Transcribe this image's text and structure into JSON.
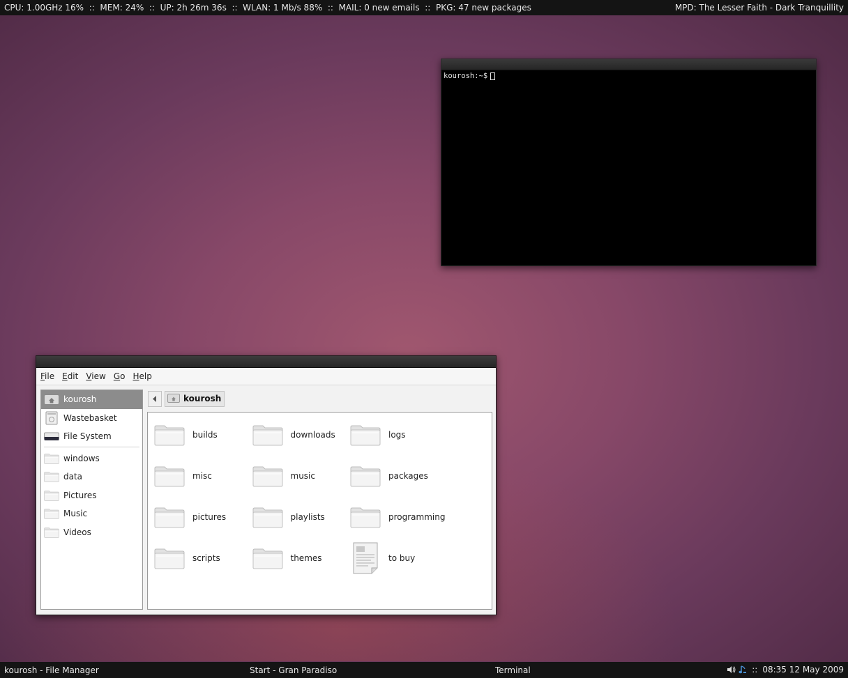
{
  "topbar": {
    "left": "CPU: 1.00GHz 16%  ::  MEM: 24%  ::  UP: 2h 26m 36s  ::  WLAN: 1 Mb/s 88%  ::  MAIL: 0 new emails  ::  PKG: 47 new packages",
    "right": "MPD: The Lesser Faith - Dark Tranquillity"
  },
  "terminal": {
    "prompt": "kourosh:~$"
  },
  "file_manager": {
    "menu": [
      {
        "key": "F",
        "rest": "ile"
      },
      {
        "key": "E",
        "rest": "dit"
      },
      {
        "key": "V",
        "rest": "iew"
      },
      {
        "key": "G",
        "rest": "o"
      },
      {
        "key": "H",
        "rest": "elp"
      }
    ],
    "sidebar": {
      "places": [
        {
          "label": "kourosh",
          "icon": "home-icon"
        },
        {
          "label": "Wastebasket",
          "icon": "trash-icon"
        },
        {
          "label": "File System",
          "icon": "drive-icon"
        }
      ],
      "bookmarks": [
        {
          "label": "windows",
          "icon": "folder-icon"
        },
        {
          "label": "data",
          "icon": "folder-icon"
        },
        {
          "label": "Pictures",
          "icon": "folder-icon"
        },
        {
          "label": "Music",
          "icon": "folder-icon"
        },
        {
          "label": "Videos",
          "icon": "folder-icon"
        }
      ]
    },
    "path": {
      "current": "kourosh"
    },
    "files": [
      {
        "name": "builds",
        "type": "folder"
      },
      {
        "name": "downloads",
        "type": "folder"
      },
      {
        "name": "logs",
        "type": "folder"
      },
      {
        "name": "misc",
        "type": "folder"
      },
      {
        "name": "music",
        "type": "folder"
      },
      {
        "name": "packages",
        "type": "folder"
      },
      {
        "name": "pictures",
        "type": "folder"
      },
      {
        "name": "playlists",
        "type": "folder"
      },
      {
        "name": "programming",
        "type": "folder"
      },
      {
        "name": "scripts",
        "type": "folder"
      },
      {
        "name": "themes",
        "type": "folder"
      },
      {
        "name": "to buy",
        "type": "document"
      }
    ]
  },
  "taskbar": {
    "task1": "kourosh - File Manager",
    "task2": "Start - Gran Paradiso",
    "task3": "Terminal",
    "sep": "::",
    "clock": "08:35 12 May 2009"
  }
}
